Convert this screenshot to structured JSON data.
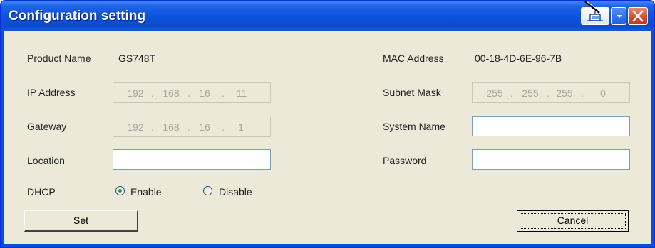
{
  "window": {
    "title": "Configuration setting"
  },
  "titlebar": {
    "icons": {
      "tool": "network-tool-icon",
      "dropdown": "chevron-down-icon",
      "close": "close-icon"
    }
  },
  "fields": {
    "product_name": {
      "label": "Product Name",
      "value": "GS748T"
    },
    "mac_address": {
      "label": "MAC Address",
      "value": "00-18-4D-6E-96-7B"
    },
    "ip_address": {
      "label": "IP Address",
      "octets": [
        "192",
        "168",
        "16",
        "11"
      ]
    },
    "subnet_mask": {
      "label": "Subnet Mask",
      "octets": [
        "255",
        "255",
        "255",
        "0"
      ]
    },
    "gateway": {
      "label": "Gateway",
      "octets": [
        "192",
        "168",
        "16",
        "1"
      ]
    },
    "system_name": {
      "label": "System Name",
      "value": ""
    },
    "location": {
      "label": "Location",
      "value": ""
    },
    "password": {
      "label": "Password",
      "value": ""
    }
  },
  "dhcp": {
    "label": "DHCP",
    "options": [
      {
        "label": "Enable",
        "selected": true
      },
      {
        "label": "Disable",
        "selected": false
      }
    ]
  },
  "buttons": {
    "set": "Set",
    "cancel": "Cancel"
  },
  "colors": {
    "titlebar": "#0a52dc",
    "dialog_bg": "#ece9d8",
    "close_button": "#d24d2a"
  }
}
